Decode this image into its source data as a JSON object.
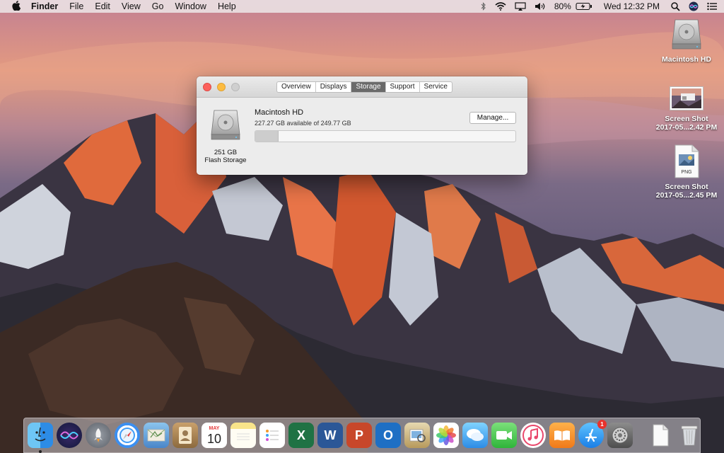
{
  "menubar": {
    "apple": "",
    "app_name": "Finder",
    "items": [
      "File",
      "Edit",
      "View",
      "Go",
      "Window",
      "Help"
    ],
    "battery_percent": "80%",
    "clock": "Wed 12:32 PM"
  },
  "desktop": {
    "icons": [
      {
        "label_line1": "Macintosh HD",
        "label_line2": ""
      },
      {
        "label_line1": "Screen Shot",
        "label_line2": "2017-05...2.42 PM"
      },
      {
        "label_line1": "Screen Shot",
        "label_line2": "2017-05...2.45 PM",
        "badge": "PNG"
      }
    ]
  },
  "window": {
    "tabs": [
      "Overview",
      "Displays",
      "Storage",
      "Support",
      "Service"
    ],
    "active_tab": "Storage",
    "disk": {
      "capacity": "251 GB",
      "type": "Flash Storage",
      "volume_name": "Macintosh HD",
      "available_text": "227.27 GB available of 249.77 GB",
      "used_fraction": 0.09
    },
    "manage_label": "Manage..."
  },
  "dock": {
    "calendar_month": "MAY",
    "calendar_day": "10",
    "app_store_badge": "1",
    "apps": [
      "finder-icon",
      "siri-icon",
      "launchpad-icon",
      "safari-icon",
      "mail-icon",
      "contacts-icon",
      "calendar-icon",
      "notes-icon",
      "reminders-icon",
      "excel-icon",
      "word-icon",
      "powerpoint-icon",
      "outlook-icon",
      "preview-icon",
      "photos-icon",
      "messages-icon",
      "facetime-icon",
      "itunes-icon",
      "ibooks-icon",
      "app-store-icon",
      "system-preferences-icon",
      "document-icon",
      "trash-icon"
    ]
  },
  "colors": {
    "close": "#fc605c",
    "minimize": "#fdbc40",
    "active_tab": "#6a6a6a"
  }
}
